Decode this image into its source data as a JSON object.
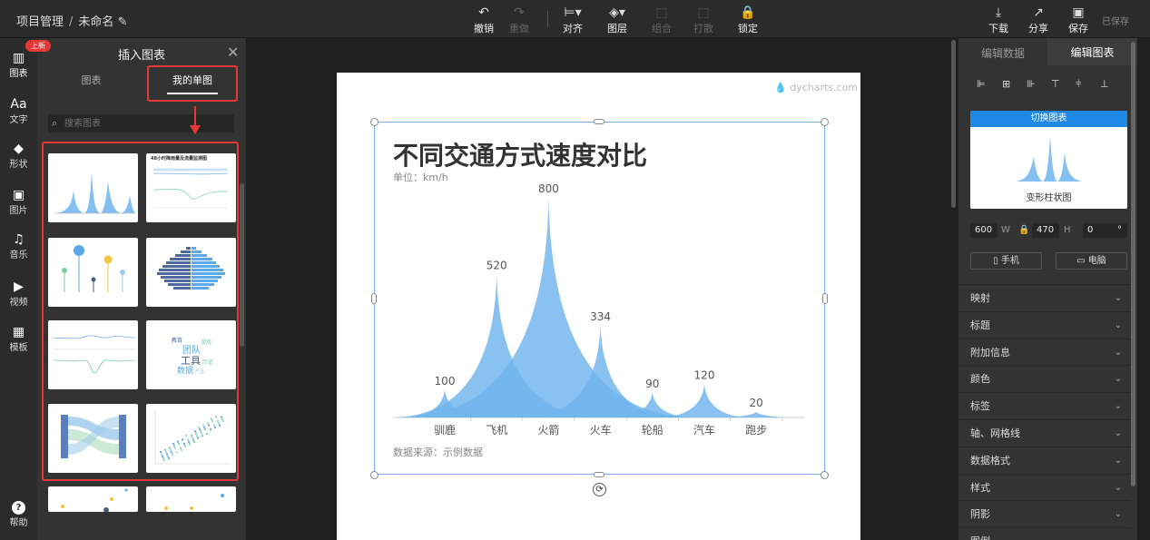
{
  "header": {
    "project": "项目管理",
    "separator": "/",
    "doc_name": "未命名",
    "saved": "已保存"
  },
  "toolbar": [
    {
      "label": "撤销",
      "icon": "undo-icon",
      "glyph": "↶",
      "dim": false
    },
    {
      "label": "重做",
      "icon": "redo-icon",
      "glyph": "↷",
      "dim": true
    },
    {
      "label": "对齐",
      "icon": "align-icon",
      "glyph": "⊨▾",
      "dim": false
    },
    {
      "label": "图层",
      "icon": "layers-icon",
      "glyph": "◈▾",
      "dim": false
    },
    {
      "label": "组合",
      "icon": "group-icon",
      "glyph": "⬚",
      "dim": true
    },
    {
      "label": "打散",
      "icon": "ungroup-icon",
      "glyph": "⬚",
      "dim": true
    },
    {
      "label": "锁定",
      "icon": "lock-icon",
      "glyph": "🔒",
      "dim": false
    }
  ],
  "actions": [
    {
      "label": "下载",
      "icon": "download-icon",
      "glyph": "⤓"
    },
    {
      "label": "分享",
      "icon": "share-icon",
      "glyph": "↗"
    },
    {
      "label": "保存",
      "icon": "save-icon",
      "glyph": "▣"
    }
  ],
  "leftnav": [
    {
      "label": "图表",
      "icon": "chart-icon",
      "glyph": "▥"
    },
    {
      "label": "文字",
      "icon": "text-icon",
      "glyph": "Aa"
    },
    {
      "label": "形状",
      "icon": "shapes-icon",
      "glyph": "◆"
    },
    {
      "label": "图片",
      "icon": "image-icon",
      "glyph": "▣"
    },
    {
      "label": "音乐",
      "icon": "music-icon",
      "glyph": "♫"
    },
    {
      "label": "视频",
      "icon": "video-icon",
      "glyph": "▶"
    },
    {
      "label": "模板",
      "icon": "template-icon",
      "glyph": "▦"
    }
  ],
  "help": {
    "label": "帮助",
    "icon": "help-icon",
    "glyph": "?"
  },
  "new_badge": "上新",
  "insert_panel": {
    "title": "插入图表",
    "tabs": [
      "图表",
      "我的单图"
    ],
    "search_placeholder": "搜索图表"
  },
  "thumb2": {
    "title": "48小时降雨量及流量监测图"
  },
  "thumb6": {
    "words": [
      "教育",
      "团队",
      "工具",
      "数据",
      "历史",
      "游戏",
      "产品"
    ]
  },
  "right_panel": {
    "tabs": [
      "编辑数据",
      "编辑图表"
    ],
    "switch_label": "切换图表",
    "chart_name": "变形柱状图",
    "width": "600",
    "w_label": "W",
    "height": "470",
    "h_label": "H",
    "rotation": "0",
    "deg": "°",
    "devices": [
      {
        "label": "手机",
        "icon": "phone-icon"
      },
      {
        "label": "电脑",
        "icon": "desktop-icon"
      }
    ],
    "sections": [
      "映射",
      "标题",
      "附加信息",
      "颜色",
      "标签",
      "轴、网格线",
      "数据格式",
      "样式",
      "阴影",
      "图例"
    ]
  },
  "canvas": {
    "brand": "dycharts.com"
  },
  "chart_data": {
    "type": "bar",
    "variant": "peak-shaped bars",
    "title": "不同交通方式速度对比",
    "subtitle": "单位：km/h",
    "source": "数据来源：示例数据",
    "categories": [
      "驯鹿",
      "飞机",
      "火箭",
      "火车",
      "轮船",
      "汽车",
      "跑步"
    ],
    "values": [
      100,
      520,
      800,
      334,
      90,
      120,
      20
    ],
    "ylim": [
      0,
      800
    ],
    "color": "#6fb4ee",
    "grid": false
  }
}
